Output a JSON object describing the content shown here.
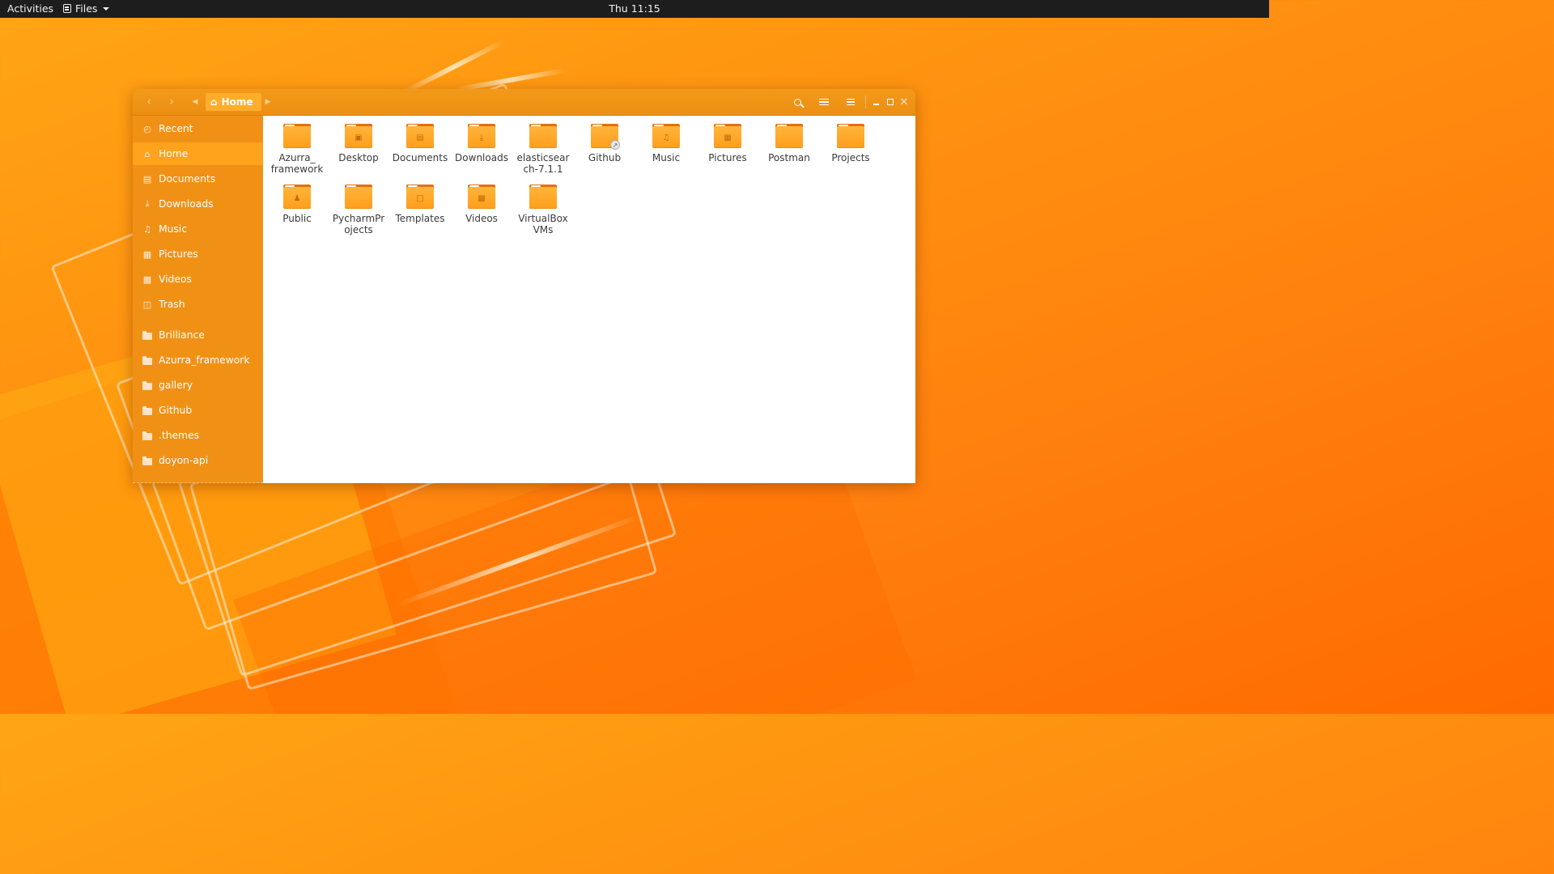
{
  "topbar": {
    "activities": "Activities",
    "app_name": "Files",
    "clock": "Thu 11:15"
  },
  "window": {
    "breadcrumb": "Home",
    "nav": {
      "back_icon": "chevron-left-icon",
      "forward_icon": "chevron-right-icon"
    },
    "controls": [
      "search-icon",
      "list-view-icon",
      "hamburger-menu-icon",
      "minimize-icon",
      "maximize-icon",
      "close-icon"
    ]
  },
  "sidebar": {
    "places": [
      {
        "label": "Recent",
        "icon": "clock-icon"
      },
      {
        "label": "Home",
        "icon": "home-icon",
        "active": true
      },
      {
        "label": "Documents",
        "icon": "document-icon"
      },
      {
        "label": "Downloads",
        "icon": "download-icon"
      },
      {
        "label": "Music",
        "icon": "music-note-icon"
      },
      {
        "label": "Pictures",
        "icon": "image-icon"
      },
      {
        "label": "Videos",
        "icon": "film-icon"
      },
      {
        "label": "Trash",
        "icon": "trash-icon"
      }
    ],
    "bookmarks": [
      {
        "label": "Brilliance"
      },
      {
        "label": "Azurra_framework"
      },
      {
        "label": "gallery"
      },
      {
        "label": "Github"
      },
      {
        "label": ".themes"
      },
      {
        "label": "doyon-api"
      }
    ]
  },
  "files": [
    {
      "name": "Azurra_\nframework",
      "emblem": ""
    },
    {
      "name": "Desktop",
      "emblem": "desktop-icon"
    },
    {
      "name": "Documents",
      "emblem": "document-icon"
    },
    {
      "name": "Downloads",
      "emblem": "download-icon"
    },
    {
      "name": "elasticsear\nch-7.1.1",
      "emblem": ""
    },
    {
      "name": "Github",
      "emblem": "symlink-badge-icon"
    },
    {
      "name": "Music",
      "emblem": "music-note-icon"
    },
    {
      "name": "Pictures",
      "emblem": "image-icon"
    },
    {
      "name": "Postman",
      "emblem": ""
    },
    {
      "name": "Projects",
      "emblem": ""
    },
    {
      "name": "Public",
      "emblem": "people-icon"
    },
    {
      "name": "PycharmPr\nojects",
      "emblem": ""
    },
    {
      "name": "Templates",
      "emblem": "template-icon"
    },
    {
      "name": "Videos",
      "emblem": "film-icon"
    },
    {
      "name": "VirtualBox\nVMs",
      "emblem": ""
    }
  ],
  "colors": {
    "accent": "#f09116",
    "active": "#ffa21c",
    "folder": "#ffa726",
    "topbar": "#1d1d1d"
  }
}
